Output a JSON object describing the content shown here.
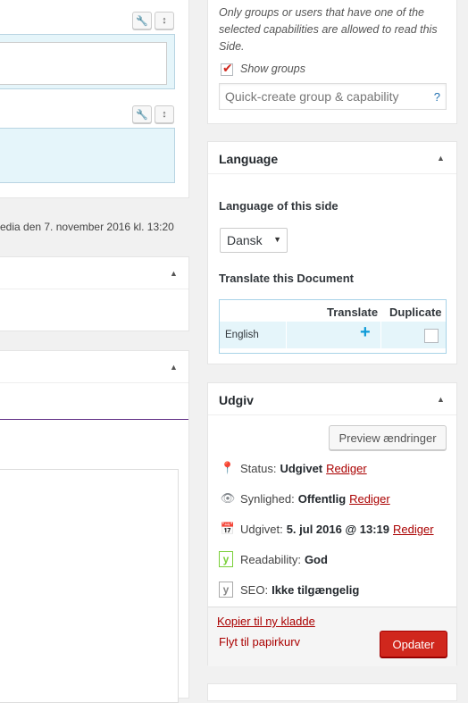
{
  "left": {
    "modified_text": "edia den 7. november 2016 kl. 13:20"
  },
  "access": {
    "note": "Only groups or users that have one of the selected capabilities are allowed to read this Side.",
    "show_groups_label": "Show groups",
    "show_groups_checked": true,
    "quick_create_placeholder": "Quick-create group & capability",
    "help_glyph": "?"
  },
  "language": {
    "title": "Language",
    "lang_label": "Language of this side",
    "selected_lang": "Dansk",
    "translate_label": "Translate this Document",
    "col_translate": "Translate",
    "col_duplicate": "Duplicate",
    "rows": [
      {
        "language": "English",
        "translate_icon": "plus-icon",
        "duplicate_checked": false
      }
    ]
  },
  "publish": {
    "title": "Udgiv",
    "preview_label": "Preview ændringer",
    "status_label": "Status:",
    "status_value": "Udgivet",
    "visibility_label": "Synlighed:",
    "visibility_value": "Offentlig",
    "published_label": "Udgivet:",
    "published_value": "5. jul 2016 @ 13:19",
    "readability_label": "Readability:",
    "readability_value": "God",
    "seo_label": "SEO:",
    "seo_value": "Ikke tilgængelig",
    "edit_label": "Rediger",
    "copy_draft_label": "Kopier til ny kladde",
    "trash_label": "Flyt til papirkurv",
    "update_label": "Opdater"
  },
  "colors": {
    "accent_red": "#d0271d",
    "link_red": "#a00",
    "field_blue": "#e5f5fa",
    "plus_blue": "#0e9bd8",
    "purple_rule": "#5e2c83",
    "readability_green": "#7ad03a"
  }
}
